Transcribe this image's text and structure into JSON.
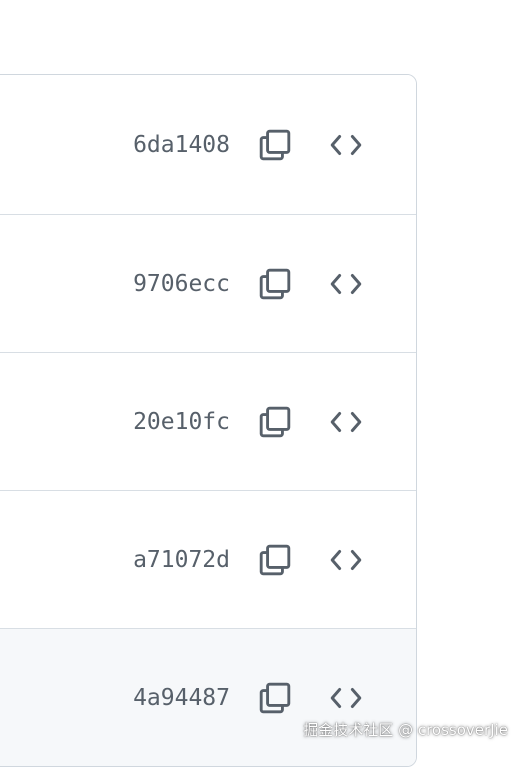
{
  "commits": [
    {
      "sha": "6da1408",
      "copy_icon": "copy-icon",
      "browse_icon": "code-icon"
    },
    {
      "sha": "9706ecc",
      "copy_icon": "copy-icon",
      "browse_icon": "code-icon"
    },
    {
      "sha": "20e10fc",
      "copy_icon": "copy-icon",
      "browse_icon": "code-icon"
    },
    {
      "sha": "a71072d",
      "copy_icon": "copy-icon",
      "browse_icon": "code-icon"
    },
    {
      "sha": "4a94487",
      "copy_icon": "copy-icon",
      "browse_icon": "code-icon"
    }
  ],
  "watermark": "掘金技术社区 @ crossoverJie",
  "colors": {
    "border": "#d0d7de",
    "row_divider": "#d8dee4",
    "hover_row": "#f6f8fa",
    "sha_text": "#57606a",
    "icon": "#57606a"
  }
}
